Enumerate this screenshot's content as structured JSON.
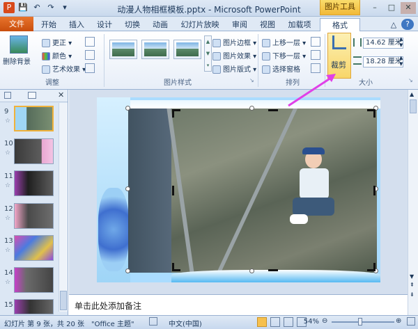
{
  "window": {
    "title": "动漫人物相框模板.pptx - Microsoft PowerPoint",
    "context_tab": "图片工具",
    "minimize": "–",
    "maximize": "□",
    "close": "✕"
  },
  "tabs": [
    "文件",
    "开始",
    "插入",
    "设计",
    "切换",
    "动画",
    "幻灯片放映",
    "审阅",
    "视图",
    "加载项",
    "格式"
  ],
  "ribbon": {
    "adjust": {
      "remove_bg": "删除背景",
      "corrections": "更正",
      "color": "颜色",
      "artistic": "艺术效果",
      "label": "调整"
    },
    "picture_styles": {
      "border": "图片边框",
      "effects": "图片效果",
      "layout": "图片版式",
      "label": "图片样式"
    },
    "arrange": {
      "bring_forward": "上移一层",
      "send_backward": "下移一层",
      "selection_pane": "选择窗格",
      "label": "排列"
    },
    "size": {
      "crop": "裁剪",
      "height": "14.62 厘米",
      "width": "18.28 厘米",
      "label": "大小"
    }
  },
  "slide_pane": {
    "thumb_numbers": [
      "9",
      "10",
      "11",
      "12",
      "13",
      "14",
      "15"
    ]
  },
  "notes": {
    "placeholder": "单击此处添加备注"
  },
  "status": {
    "slide_info": "幻灯片 第 9 张，共 20 张",
    "theme": "\"Office 主题\"",
    "language": "中文(中国)",
    "zoom": "54%"
  },
  "colors": {
    "file_tab": "#d55f1b",
    "context": "#f2b938",
    "accent_arrow": "#e040e8"
  }
}
